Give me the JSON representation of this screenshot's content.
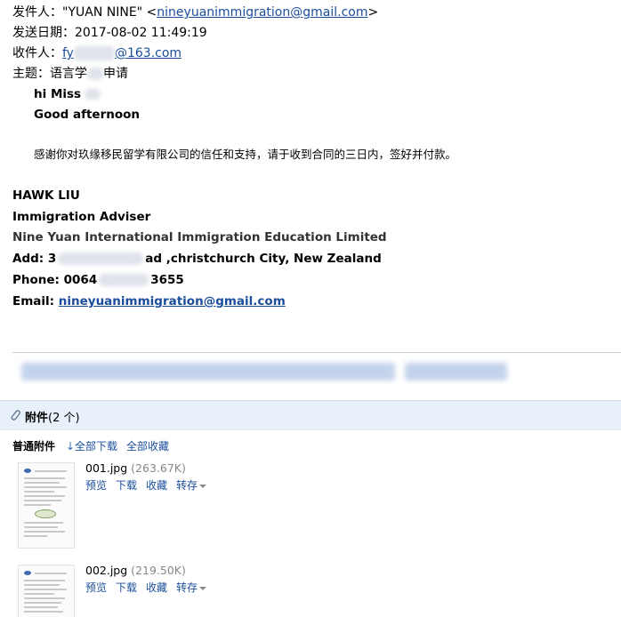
{
  "email": {
    "from_label": "发件人：",
    "from_name": "\"YUAN NINE\"",
    "from_lt": " <",
    "from_email": "nineyuanimmigration@gmail.com",
    "from_gt": ">",
    "date_label": "发送日期：",
    "date_value": "2017-08-02 11:49:19",
    "to_label": "收件人：",
    "to_prefix": "fy",
    "to_suffix": "@163.com",
    "subject_label": "主题：",
    "subject_start": "语言学",
    "subject_end": "申请"
  },
  "body": {
    "greeting1": "hi  Miss",
    "greeting2": "Good  afternoon",
    "message": "感谢你对玖缘移民留学有限公司的信任和支持，请于收到合同的三日内，签好并付款。"
  },
  "signature": {
    "name": "HAWK  LIU",
    "role": "Immigration Adviser",
    "company": "Nine Yuan International Immigration Education Limited",
    "address_label": "Add: 3",
    "address_rest": "ad ,christchurch City, New Zealand",
    "phone_label": "Phone: 0064",
    "phone_rest": "3655",
    "email_label": "Email: ",
    "email_value": "nineyuanimmigration@gmail.com"
  },
  "attachments": {
    "title": "附件",
    "count": "(2 个)",
    "section_label": "普通附件",
    "download_all": "全部下载",
    "save_all": "全部收藏",
    "files": [
      {
        "name": "001.jpg",
        "size": "(263.67K)"
      },
      {
        "name": "002.jpg",
        "size": "(219.50K)"
      }
    ],
    "actions": {
      "preview": "预览",
      "download": "下载",
      "favorite": "收藏",
      "save_to": "转存"
    }
  },
  "colors": {
    "link": "#1a4e9c",
    "attachment_bar": "#e8f0fa"
  },
  "icons": [
    "paperclip-icon",
    "download-arrow-icon",
    "dropdown-caret-icon"
  ]
}
